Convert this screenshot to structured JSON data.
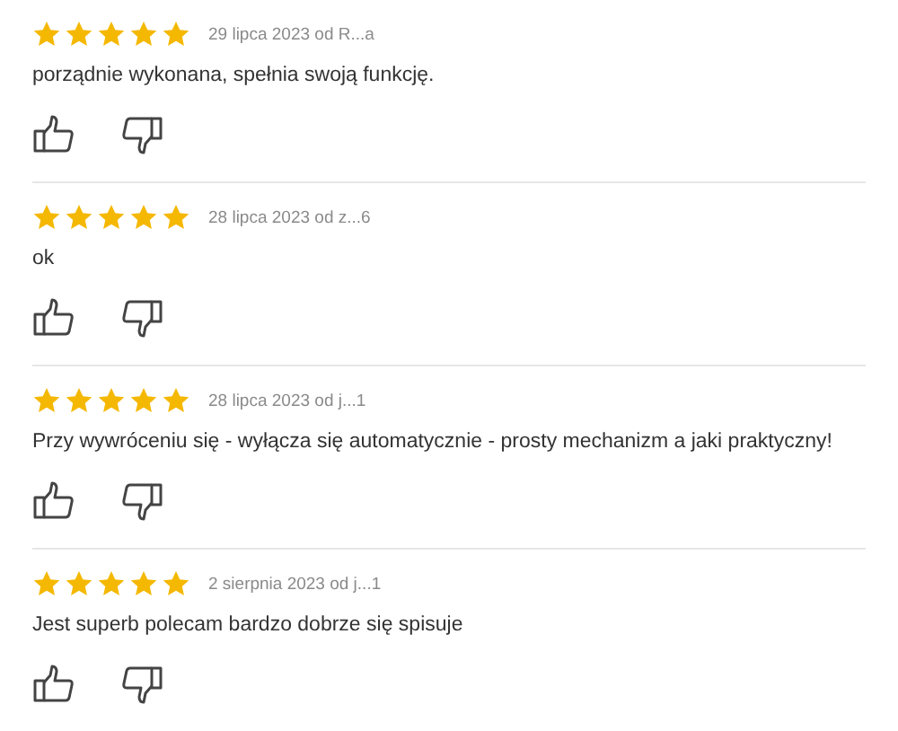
{
  "reviews": [
    {
      "stars": 5,
      "meta": "29 lipca 2023 od R...a",
      "text": "porządnie wykonana, spełnia swoją funkcję."
    },
    {
      "stars": 5,
      "meta": "28 lipca 2023 od z...6",
      "text": "ok"
    },
    {
      "stars": 5,
      "meta": "28 lipca 2023 od j...1",
      "text": "Przy wywróceniu się - wyłącza się automatycznie - prosty mechanizm a jaki praktyczny!"
    },
    {
      "stars": 5,
      "meta": "2 sierpnia 2023 od j...1",
      "text": "Jest superb polecam bardzo dobrze się spisuje"
    }
  ]
}
